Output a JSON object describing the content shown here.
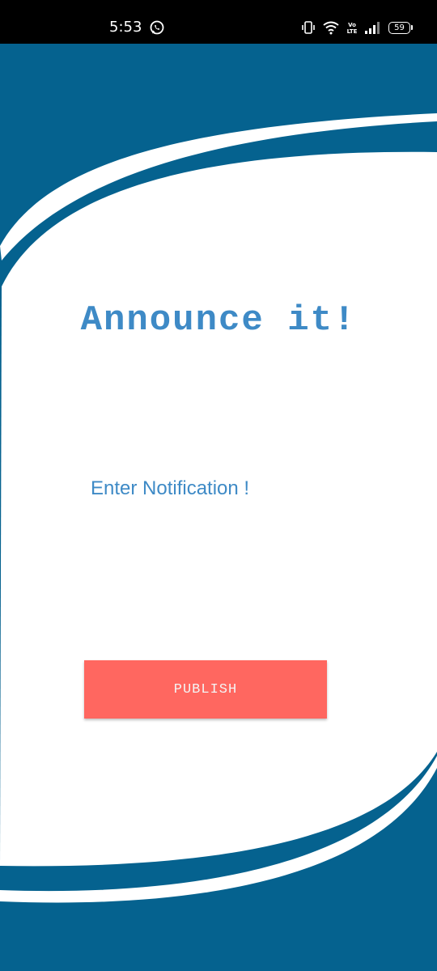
{
  "status_bar": {
    "time": "5:53",
    "battery_level": "59",
    "icons": [
      "whatsapp-icon",
      "vibrate-icon",
      "wifi-icon",
      "volte-icon",
      "signal-icon",
      "battery-icon"
    ],
    "volte_label": "Vo LTE"
  },
  "colors": {
    "primary_blue": "#05628f",
    "accent_text": "#3e8ac6",
    "button_bg": "#ff6760",
    "button_text": "#f4f4f4"
  },
  "main": {
    "heading": "Announce it!",
    "notification_placeholder": "Enter Notification !",
    "notification_value": "",
    "publish_label": "PUBLISH"
  }
}
